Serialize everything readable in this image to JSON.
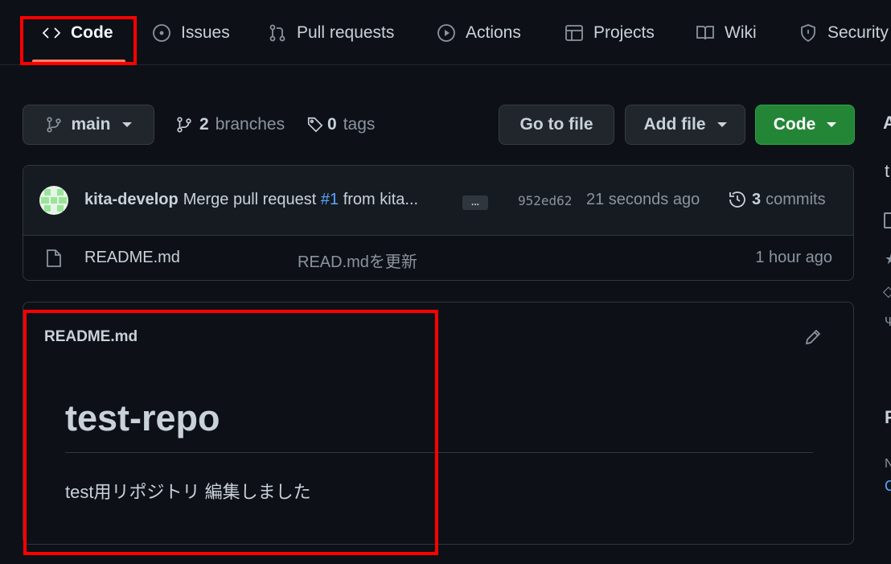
{
  "tabs": [
    {
      "label": "Code",
      "icon": "code-icon",
      "active": true
    },
    {
      "label": "Issues",
      "icon": "issue-icon"
    },
    {
      "label": "Pull requests",
      "icon": "pull-request-icon"
    },
    {
      "label": "Actions",
      "icon": "play-icon"
    },
    {
      "label": "Projects",
      "icon": "table-icon"
    },
    {
      "label": "Wiki",
      "icon": "book-icon"
    },
    {
      "label": "Security",
      "icon": "shield-icon"
    }
  ],
  "branch": {
    "label": "main"
  },
  "branches": {
    "count": "2",
    "label": "branches"
  },
  "tags": {
    "count": "0",
    "label": "tags"
  },
  "buttons": {
    "go_to_file": "Go to file",
    "add_file": "Add file",
    "code": "Code"
  },
  "commit": {
    "author": "kita-develop",
    "message_prefix": "Merge pull request ",
    "pr": "#1",
    "message_suffix": " from kita...",
    "more": "...",
    "sha": "952ed62",
    "time": "21 seconds ago",
    "commits_count": "3",
    "commits_label": "commits"
  },
  "files": [
    {
      "name": "README.md",
      "message": "READ.mdを更新",
      "time": "1 hour ago"
    }
  ],
  "readme": {
    "filename": "README.md",
    "heading": "test-repo",
    "body": "test用リポジトリ 編集しました"
  },
  "sidebar_peek": {
    "a": "A",
    "t": "t",
    "f": "F",
    "n": "N",
    "c": "C"
  },
  "colors": {
    "accent_link": "#58a6ff",
    "green_button": "#238636",
    "highlight": "#ff0000"
  }
}
